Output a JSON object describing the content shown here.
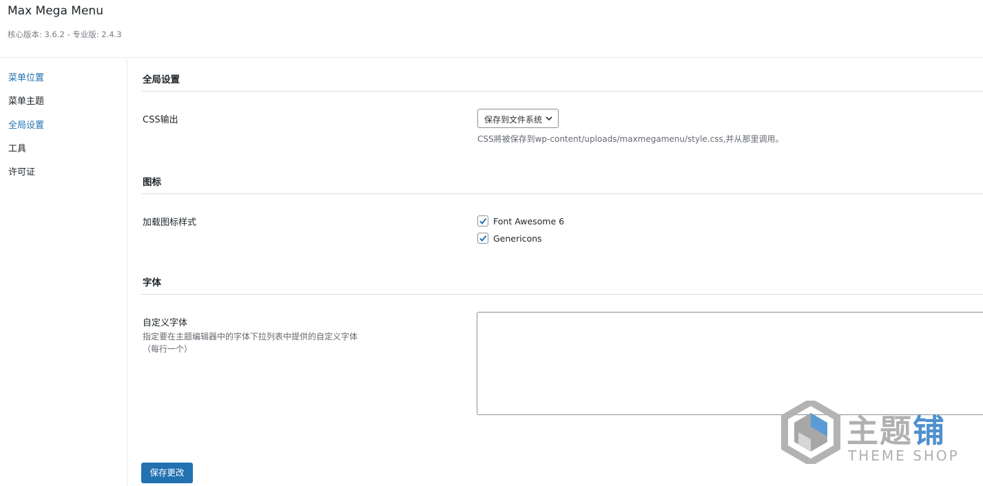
{
  "header": {
    "title": "Max Mega Menu",
    "version": "核心版本: 3.6.2 - 专业版: 2.4.3"
  },
  "sidebar": {
    "items": [
      {
        "label": "菜单位置"
      },
      {
        "label": "菜单主题"
      },
      {
        "label": "全局设置"
      },
      {
        "label": "工具"
      },
      {
        "label": "许可证"
      }
    ]
  },
  "sections": {
    "global": {
      "title": "全局设置",
      "css_output_label": "CSS输出",
      "css_output_value": "保存到文件系统",
      "css_output_desc": "CSS將被保存到wp-content/uploads/maxmegamenu/style.css,并从那里调用。"
    },
    "icons": {
      "title": "图标",
      "label": "加载图标样式",
      "options": [
        {
          "label": "Font Awesome 6",
          "checked": true
        },
        {
          "label": "Genericons",
          "checked": true
        }
      ]
    },
    "fonts": {
      "title": "字体",
      "label": "自定义字体",
      "desc_line1": "指定要在主题编辑器中的字体下拉列表中提供的自定义字体",
      "desc_line2": "（每行一个）",
      "value": ""
    }
  },
  "save_button": "保存更改",
  "watermark": {
    "cn_main": "主题",
    "cn_accent": "铺",
    "en": "THEME SHOP"
  },
  "colors": {
    "accent": "#2271b1",
    "link": "#2271b1",
    "border": "#8c8f94",
    "divider": "#dcdcde"
  }
}
